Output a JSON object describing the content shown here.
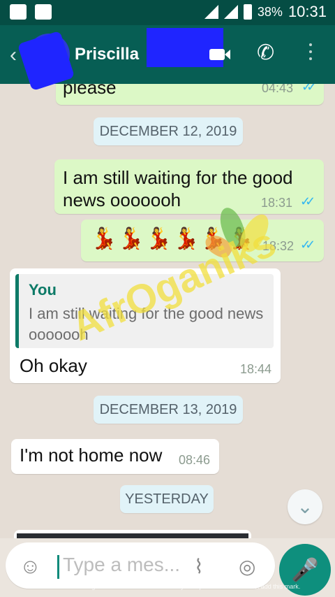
{
  "statusbar": {
    "battery": "38%",
    "time": "10:31"
  },
  "header": {
    "name": "Priscilla"
  },
  "chat": {
    "msg_prev": {
      "text": "please",
      "time": "04:43"
    },
    "date1": "DECEMBER 12, 2019",
    "msg1": {
      "text": "I am still waiting for the good news ooooooh",
      "time": "18:31"
    },
    "msg2": {
      "emoji": "💃💃💃💃💃💃",
      "time": "18:32"
    },
    "reply": {
      "quoted_author": "You",
      "quoted_text": "I am still waiting for the good news ooooooh",
      "text": "Oh okay",
      "time": "18:44"
    },
    "date2": "DECEMBER 13, 2019",
    "msg3": {
      "text": "I'm not home now",
      "time": "08:46"
    },
    "date3": "YESTERDAY"
  },
  "input": {
    "placeholder": "Type a mes..."
  },
  "watermark": {
    "text": "AfrOganiks"
  },
  "footer": "Processed using the free version of Watermarkly. The paid version does not add this mark.",
  "colors": {
    "header": "#075e54",
    "accent": "#0e8f7d",
    "outgoing": "#dcf8c6"
  },
  "icons": [
    "back-arrow-icon",
    "video-call-icon",
    "phone-icon",
    "menu-icon",
    "emoji-icon",
    "attach-icon",
    "camera-icon",
    "mic-icon",
    "chevron-down-icon"
  ]
}
